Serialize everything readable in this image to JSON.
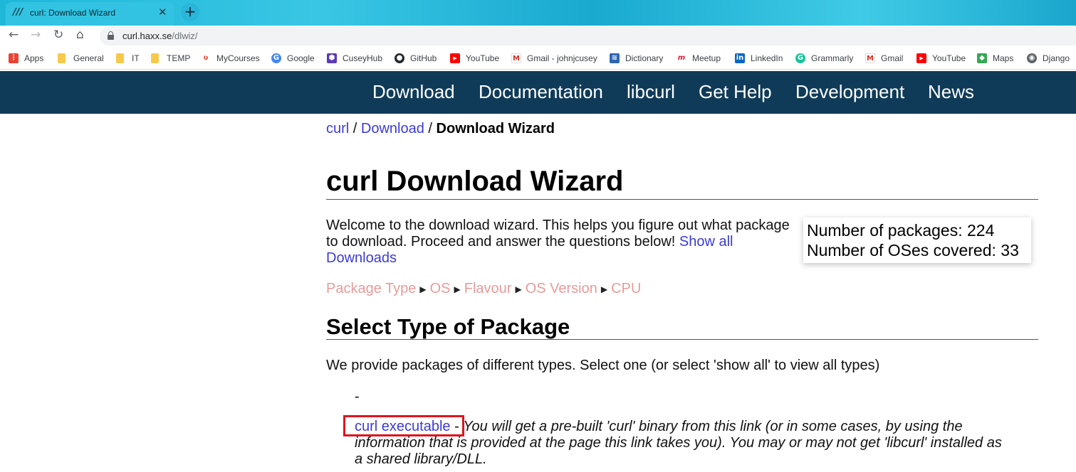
{
  "browser": {
    "tab_title": "curl: Download Wizard",
    "tab_favicon": "///",
    "url_host": "curl.haxx.se",
    "url_path": "/dlwiz/"
  },
  "bookmarks": [
    {
      "label": "Apps",
      "icon": "apps-grid-icon",
      "color": "#ea4335"
    },
    {
      "label": "General",
      "icon": "folder-icon",
      "color": "#f6c94a"
    },
    {
      "label": "IT",
      "icon": "folder-icon",
      "color": "#f6c94a"
    },
    {
      "label": "TEMP",
      "icon": "folder-icon",
      "color": "#f6c94a"
    },
    {
      "label": "MyCourses",
      "icon": "mycourses-icon",
      "color": "#d9473a"
    },
    {
      "label": "Google",
      "icon": "google-icon",
      "color": "#4285f4"
    },
    {
      "label": "CuseyHub",
      "icon": "cuseyhub-icon",
      "color": "#5b3ab8"
    },
    {
      "label": "GitHub",
      "icon": "github-icon",
      "color": "#24292e"
    },
    {
      "label": "YouTube",
      "icon": "youtube-icon",
      "color": "#ff0000"
    },
    {
      "label": "Gmail - johnjcusey",
      "icon": "gmail-icon",
      "color": "#d93025"
    },
    {
      "label": "Dictionary",
      "icon": "dictionary-icon",
      "color": "#2f66b3"
    },
    {
      "label": "Meetup",
      "icon": "meetup-icon",
      "color": "#e51937"
    },
    {
      "label": "LinkedIn",
      "icon": "linkedin-icon",
      "color": "#0a66c2"
    },
    {
      "label": "Grammarly",
      "icon": "grammarly-icon",
      "color": "#15c39a"
    },
    {
      "label": "Gmail",
      "icon": "gmail-icon",
      "color": "#d93025"
    },
    {
      "label": "YouTube",
      "icon": "youtube-icon",
      "color": "#ff0000"
    },
    {
      "label": "Maps",
      "icon": "maps-icon",
      "color": "#34a853"
    },
    {
      "label": "Django",
      "icon": "django-icon",
      "color": "#5f6368"
    }
  ],
  "sitenav": {
    "items": [
      "Download",
      "Documentation",
      "libcurl",
      "Get Help",
      "Development",
      "News"
    ]
  },
  "breadcrumb": {
    "root": "curl",
    "sep": " / ",
    "parent": "Download",
    "current": "Download Wizard"
  },
  "page": {
    "title": "curl Download Wizard",
    "intro": "Welcome to the download wizard. This helps you figure out what package to download. Proceed and answer the questions below! ",
    "intro_link": "Show all Downloads",
    "stats_packages": "Number of packages: 224",
    "stats_oses": "Number of OSes covered: 33",
    "steps": [
      "Package Type",
      "OS",
      "Flavour",
      "OS Version",
      "CPU"
    ],
    "step_arrow": "▶",
    "section_title": "Select Type of Package",
    "section_desc": "We provide packages of different types. Select one (or select 'show all' to view all types)",
    "dash_item": "-",
    "item_link": "curl executable",
    "item_sep": " - ",
    "item_note": "You will get a pre-built 'curl' binary from this link (or in some cases, by using the information that is provided at the page this link takes you). You may or may not get 'libcurl' installed as a shared library/DLL."
  }
}
